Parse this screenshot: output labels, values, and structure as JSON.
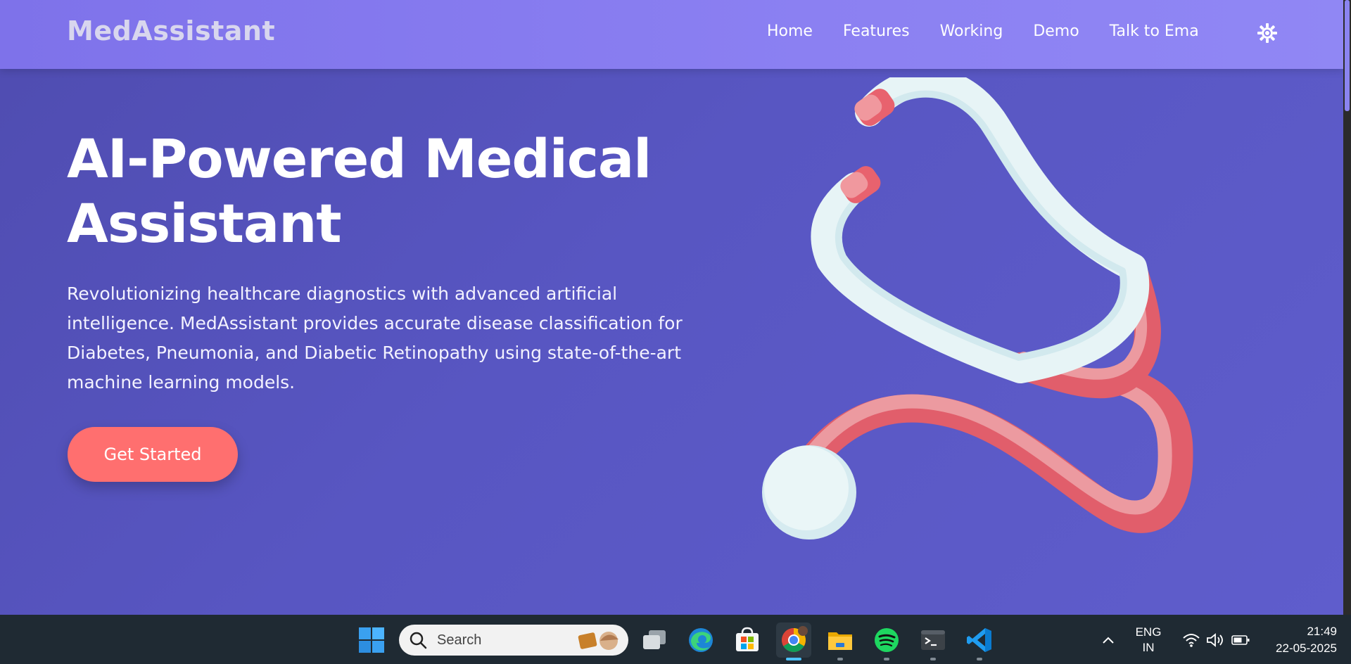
{
  "navbar": {
    "brand": "MedAssistant",
    "links": [
      "Home",
      "Features",
      "Working",
      "Demo",
      "Talk to Ema"
    ],
    "theme_icon": "sun-icon"
  },
  "hero": {
    "title_line1": "AI-Powered Medical",
    "title_line2": "Assistant",
    "description": "Revolutionizing healthcare diagnostics with advanced artificial intelligence. MedAssistant provides accurate disease classification for Diabetes, Pneumonia, and Diabetic Retinopathy using state-of-the-art machine learning models.",
    "cta_label": "Get Started",
    "illustration_icon": "stethoscope-icon"
  },
  "colors": {
    "accent": "#ff6f6f",
    "navbar": "#8b80f2",
    "hero_bg": "#5856c2"
  },
  "taskbar": {
    "search_placeholder": "Search",
    "apps": [
      "windows-start-icon",
      "task-view-icon",
      "edge-icon",
      "store-icon",
      "chrome-icon",
      "file-explorer-icon",
      "spotify-icon",
      "terminal-icon",
      "vscode-icon"
    ],
    "language_line1": "ENG",
    "language_line2": "IN",
    "time": "21:49",
    "date": "22-05-2025"
  }
}
